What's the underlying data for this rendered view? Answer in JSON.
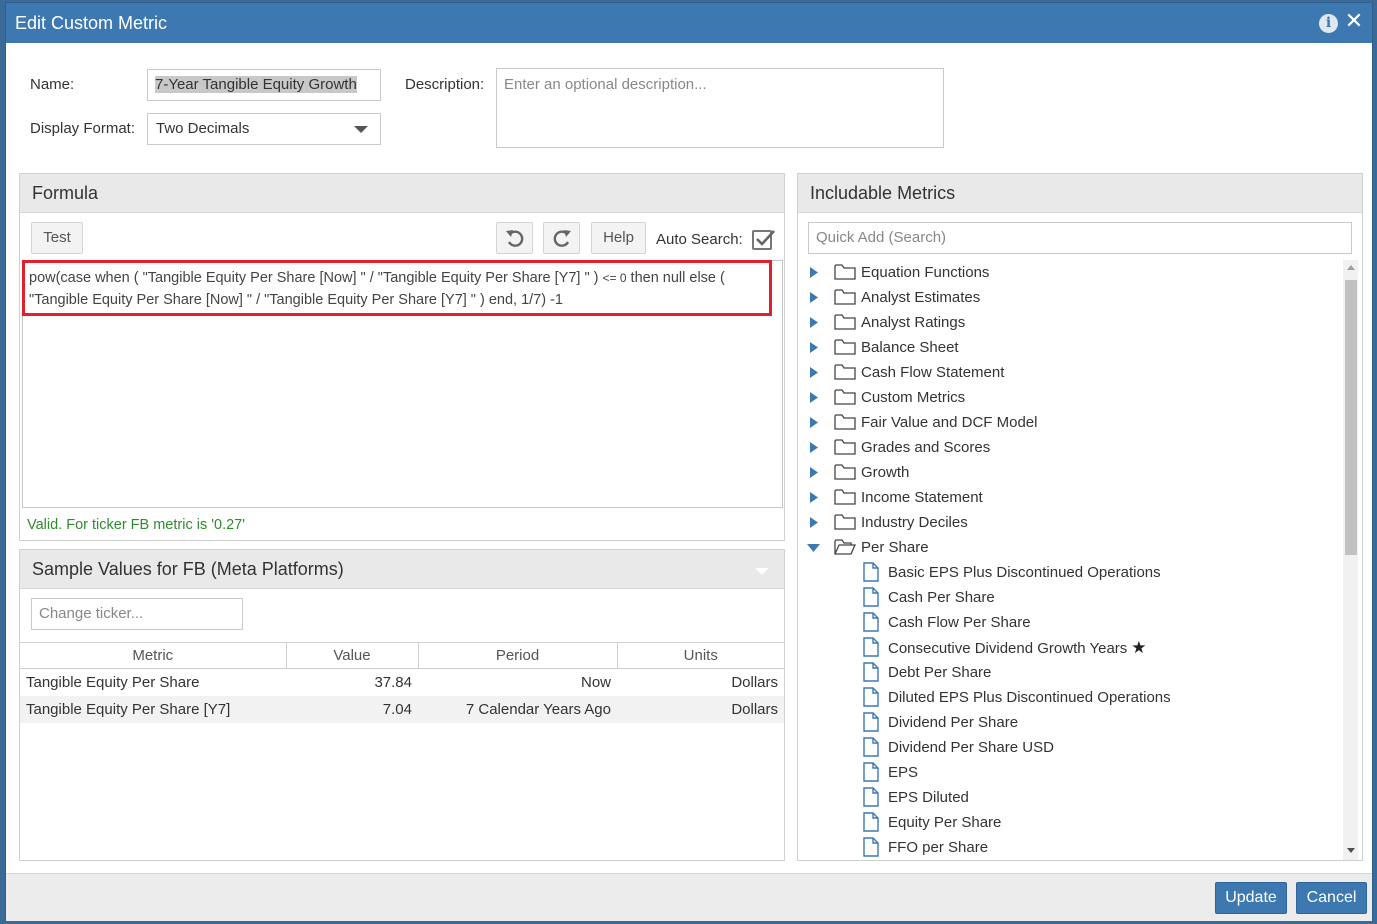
{
  "dialog": {
    "title": "Edit Custom Metric",
    "info_icon": "info-icon",
    "close_icon": "close-icon"
  },
  "form": {
    "name_label": "Name:",
    "name_value": "7-Year Tangible Equity Growth",
    "display_format_label": "Display Format:",
    "display_format_value": "Two Decimals",
    "description_label": "Description:",
    "description_placeholder": "Enter an optional description..."
  },
  "formula": {
    "header": "Formula",
    "test_label": "Test",
    "help_label": "Help",
    "auto_search_label": "Auto Search:",
    "auto_search_checked": true,
    "line1_start": "pow(case when ( \"Tangible Equity Per Share [Now] \" / \"Tangible Equity Per Share [Y7] \" )",
    "line1_op": "<= 0",
    "line1_end": "then null else (",
    "line2": "\"Tangible Equity Per Share [Now] \"  /  \"Tangible Equity Per Share [Y7] \" ) end, 1/7)  -1",
    "status": "Valid. For ticker FB metric is '0.27'",
    "status_color": "#2e8b2e",
    "highlight_color": "#e0202a"
  },
  "sample": {
    "header": "Sample Values for FB (Meta Platforms)",
    "ticker_placeholder": "Change ticker...",
    "columns": [
      "Metric",
      "Value",
      "Period",
      "Units"
    ],
    "rows": [
      {
        "metric": "Tangible Equity Per Share",
        "value": "37.84",
        "period": "Now",
        "units": "Dollars"
      },
      {
        "metric": "Tangible Equity Per Share [Y7]",
        "value": "7.04",
        "period": "7 Calendar Years Ago",
        "units": "Dollars"
      }
    ]
  },
  "metrics": {
    "header": "Includable Metrics",
    "search_placeholder": "Quick Add (Search)",
    "folders": [
      "Equation Functions",
      "Analyst Estimates",
      "Analyst Ratings",
      "Balance Sheet",
      "Cash Flow Statement",
      "Custom Metrics",
      "Fair Value and DCF Model",
      "Grades and Scores",
      "Growth",
      "Income Statement",
      "Industry Deciles"
    ],
    "open_folder": "Per Share",
    "items": [
      "Basic EPS Plus Discontinued Operations",
      "Cash Per Share",
      "Cash Flow Per Share",
      "Consecutive Dividend Growth Years",
      "Debt Per Share",
      "Diluted EPS Plus Discontinued Operations",
      "Dividend Per Share",
      "Dividend Per Share USD",
      "EPS",
      "EPS Diluted",
      "Equity Per Share",
      "FFO per Share"
    ],
    "starred_item": "Consecutive Dividend Growth Years",
    "star_glyph": "★"
  },
  "footer": {
    "update_label": "Update",
    "cancel_label": "Cancel"
  },
  "colors": {
    "accent": "#3d79b0",
    "panel_header": "#e9e9e9",
    "tree_arrow": "#3d79b0"
  }
}
